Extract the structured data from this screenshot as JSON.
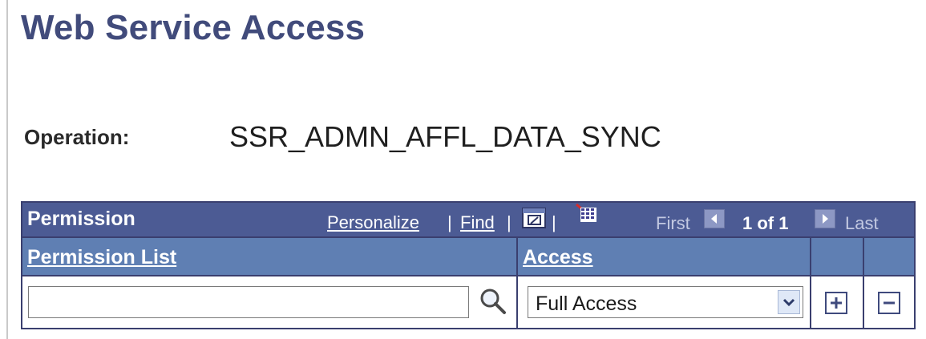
{
  "page": {
    "title": "Web Service Access"
  },
  "operation": {
    "label": "Operation:",
    "value": "SSR_ADMN_AFFL_DATA_SYNC"
  },
  "grid": {
    "title": "Permission",
    "personalize_label": "Personalize",
    "separator": "|",
    "find_label": "Find",
    "first_label": "First",
    "count_label": "1 of 1",
    "last_label": "Last",
    "columns": [
      {
        "label": "Permission List"
      },
      {
        "label": "Access"
      }
    ],
    "rows": [
      {
        "permission_list_value": "",
        "access_value": "Full Access"
      }
    ],
    "icons": {
      "view_all": "new-window-icon",
      "download": "spreadsheet-icon",
      "lookup": "search-icon",
      "dropdown": "chevron-down-icon",
      "add": "plus-icon",
      "delete": "minus-icon",
      "first": "arrow-left-icon",
      "last": "arrow-right-icon"
    },
    "colors": {
      "header_bg": "#4c5b94",
      "column_header_bg": "#5f7fb3",
      "title_color": "#414b7b"
    }
  }
}
